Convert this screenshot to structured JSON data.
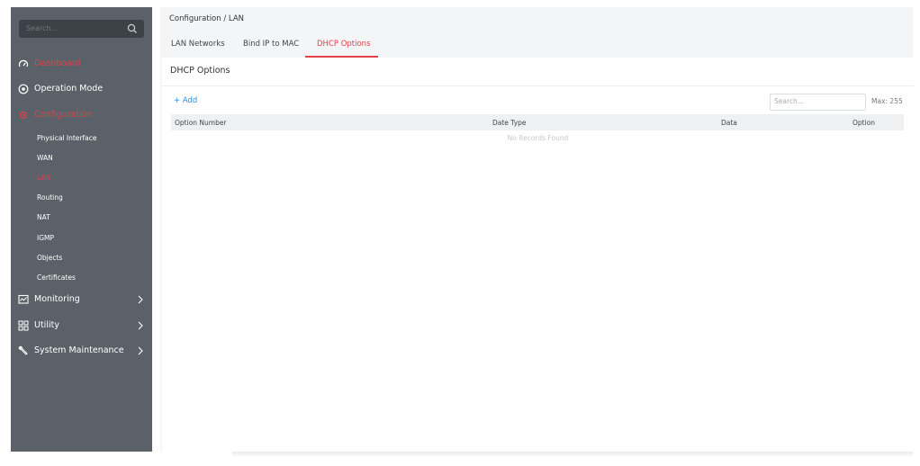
{
  "sidebar": {
    "search_placeholder": "Search...",
    "items": [
      {
        "label": "Dashboard",
        "icon": "dashboard-icon",
        "active": true
      },
      {
        "label": "Operation Mode",
        "icon": "operation-mode-icon",
        "active": false
      },
      {
        "label": "Configuration",
        "icon": "configuration-icon",
        "active": true
      }
    ],
    "sub_items": [
      {
        "label": "Physical Interface",
        "active": false
      },
      {
        "label": "WAN",
        "active": false
      },
      {
        "label": "LAN",
        "active": true
      },
      {
        "label": "Routing",
        "active": false
      },
      {
        "label": "NAT",
        "active": false
      },
      {
        "label": "IGMP",
        "active": false
      },
      {
        "label": "Objects",
        "active": false
      },
      {
        "label": "Certificates",
        "active": false
      }
    ],
    "bottom_items": [
      {
        "label": "Monitoring",
        "icon": "monitoring-icon"
      },
      {
        "label": "Utility",
        "icon": "utility-icon"
      },
      {
        "label": "System Maintenance",
        "icon": "system-maintenance-icon"
      }
    ]
  },
  "header": {
    "breadcrumb": "Configuration / LAN"
  },
  "tabs": [
    {
      "label": "LAN Networks",
      "active": false
    },
    {
      "label": "Bind IP to MAC",
      "active": false
    },
    {
      "label": "DHCP Options",
      "active": true
    }
  ],
  "panel": {
    "title": "DHCP Options",
    "add_label": "+ Add",
    "search_placeholder": "Search...",
    "max_label": "Max: 255",
    "columns": [
      "Option Number",
      "Date Type",
      "Data",
      "Option"
    ],
    "empty_message": "No Records Found"
  },
  "colors": {
    "accent": "#e2404b",
    "link": "#2d8ee0",
    "sidebar_bg": "#5b6168"
  }
}
